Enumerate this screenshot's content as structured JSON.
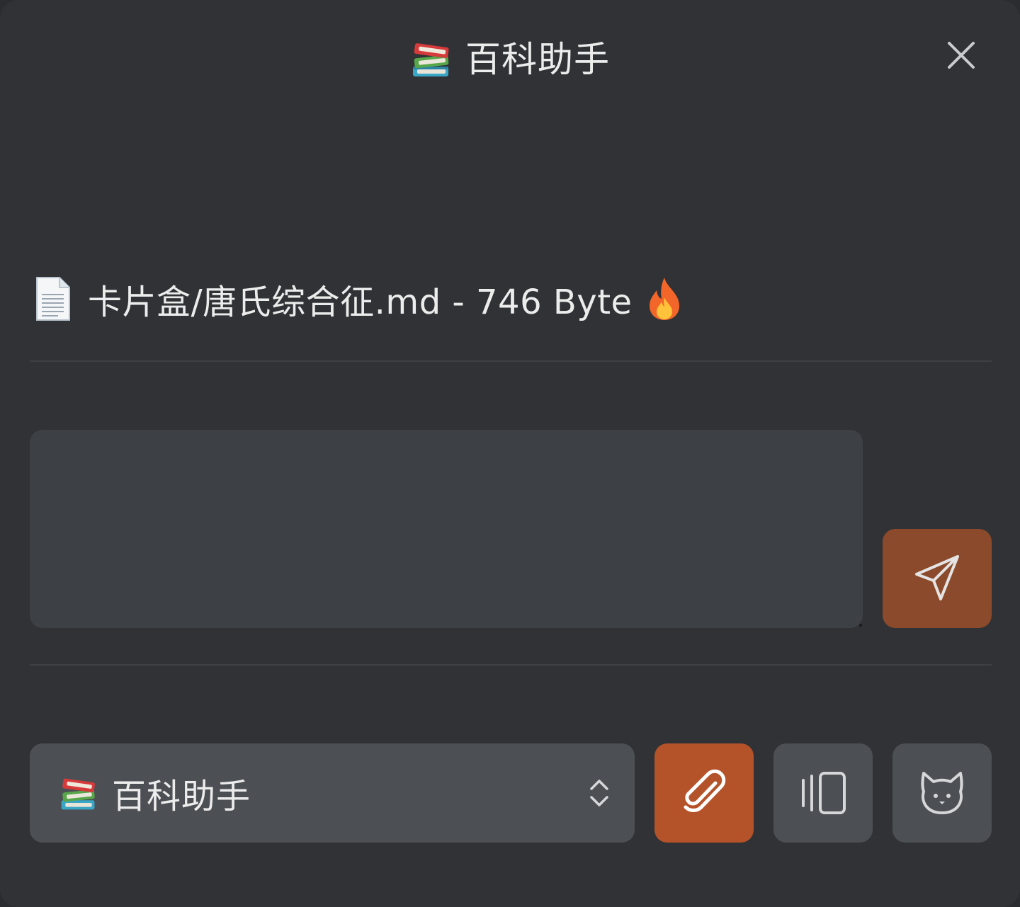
{
  "header": {
    "title": "百科助手",
    "title_icon": "books-emoji",
    "close_icon": "close-icon"
  },
  "file": {
    "icon": "document-emoji",
    "label": "卡片盒/唐氏综合征.md - 746 Byte",
    "status_icon": "fire-emoji"
  },
  "composer": {
    "value": "",
    "placeholder": "",
    "send_icon": "send-icon"
  },
  "toolbar": {
    "assistant_label": "百科助手",
    "assistant_icon": "books-emoji",
    "selector_icon": "chevron-up-down-icon",
    "attach_icon": "paperclip-icon",
    "layout_icon": "layout-stack-icon",
    "cat_icon": "cat-icon"
  },
  "colors": {
    "background": "#303235",
    "input_bg": "#3d4044",
    "control_bg": "#4c4f53",
    "send_bg": "#8b4a2b",
    "attach_bg": "#b4532a",
    "text": "#ececec"
  }
}
